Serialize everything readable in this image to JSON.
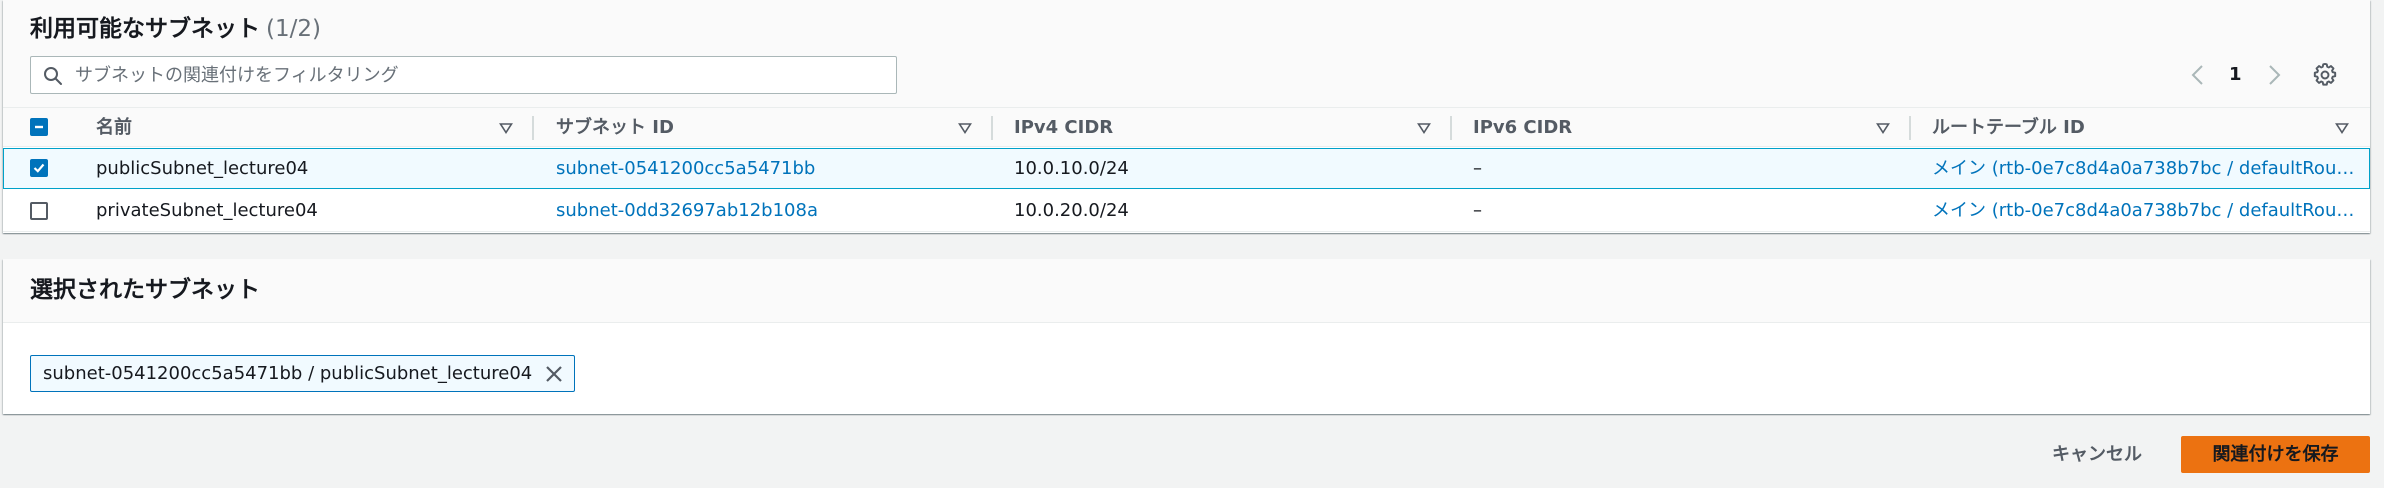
{
  "available_subnets": {
    "title": "利用可能なサブネット",
    "count": "(1/2)",
    "search_placeholder": "サブネットの関連付けをフィルタリング",
    "page": "1",
    "columns": [
      "名前",
      "サブネット ID",
      "IPv4 CIDR",
      "IPv6 CIDR",
      "ルートテーブル ID"
    ],
    "rows": [
      {
        "checked": true,
        "name": "publicSubnet_lecture04",
        "subnet_id": "subnet-0541200cc5a5471bb",
        "ipv4_cidr": "10.0.10.0/24",
        "ipv6_cidr": "–",
        "route_table": "メイン (rtb-0e7c8d4a0a738b7bc / defaultRou…"
      },
      {
        "checked": false,
        "name": "privateSubnet_lecture04",
        "subnet_id": "subnet-0dd32697ab12b108a",
        "ipv4_cidr": "10.0.20.0/24",
        "ipv6_cidr": "–",
        "route_table": "メイン (rtb-0e7c8d4a0a738b7bc / defaultRou…"
      }
    ]
  },
  "selected_subnets": {
    "title": "選択されたサブネット",
    "tokens": [
      "subnet-0541200cc5a5471bb / publicSubnet_lecture04"
    ]
  },
  "footer": {
    "cancel_label": "キャンセル",
    "save_label": "関連付けを保存"
  },
  "colors": {
    "link": "#0073bb",
    "primary_button": "#ec7211",
    "selected_row_bg": "#f1faff",
    "selected_row_border": "#00a1c9"
  }
}
